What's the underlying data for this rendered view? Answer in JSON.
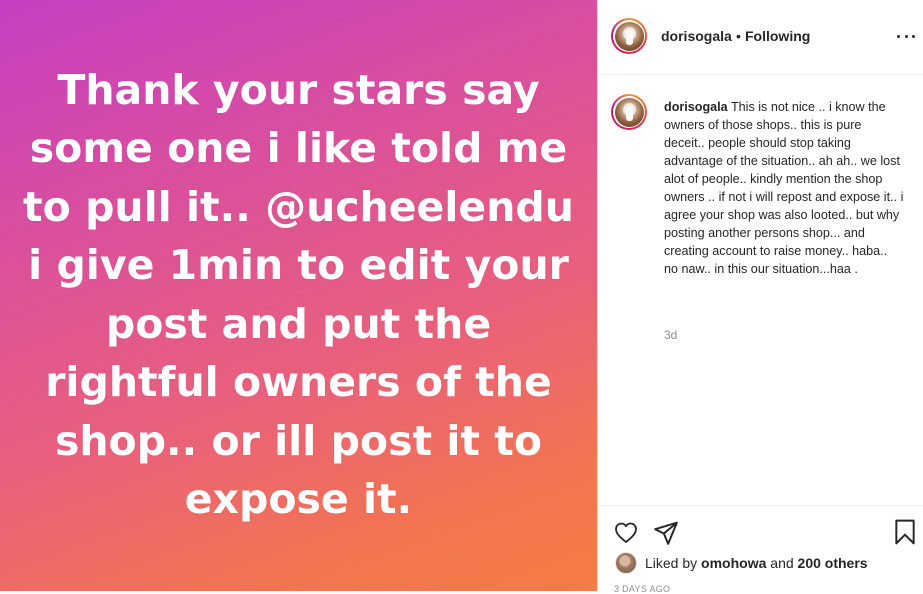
{
  "post": {
    "story_text": "Thank your stars say some one i like told me to pull it.. @ucheelendu i give 1min to edit your post and put the rightful owners of the shop.. or ill post it to expose it."
  },
  "header": {
    "username": "dorisogala",
    "separator": "•",
    "follow_status": "Following",
    "more_icon": "more-horizontal-icon"
  },
  "caption": {
    "username": "dorisogala",
    "text": "This is not nice .. i know the owners of those shops.. this is pure deceit.. people should stop taking advantage of the situation.. ah ah.. we lost alot of people.. kindly mention the shop owners .. if not i will repost and expose it.. i agree your shop was also looted.. but why posting another persons shop... and creating account to raise money.. haba.. no naw.. in this our situation...haa .",
    "age": "3d"
  },
  "actions": {
    "like_icon": "heart-icon",
    "share_icon": "paper-plane-icon",
    "save_icon": "bookmark-icon"
  },
  "likes": {
    "prefix": "Liked by",
    "liker": "omohowa",
    "conjunction": "and",
    "others": "200 others"
  },
  "timestamp": "3 DAYS AGO",
  "colors": {
    "gradient_start": "#c63fc3",
    "gradient_end": "#f47c45",
    "text_primary": "#262626",
    "text_muted": "#8e8e8e"
  }
}
